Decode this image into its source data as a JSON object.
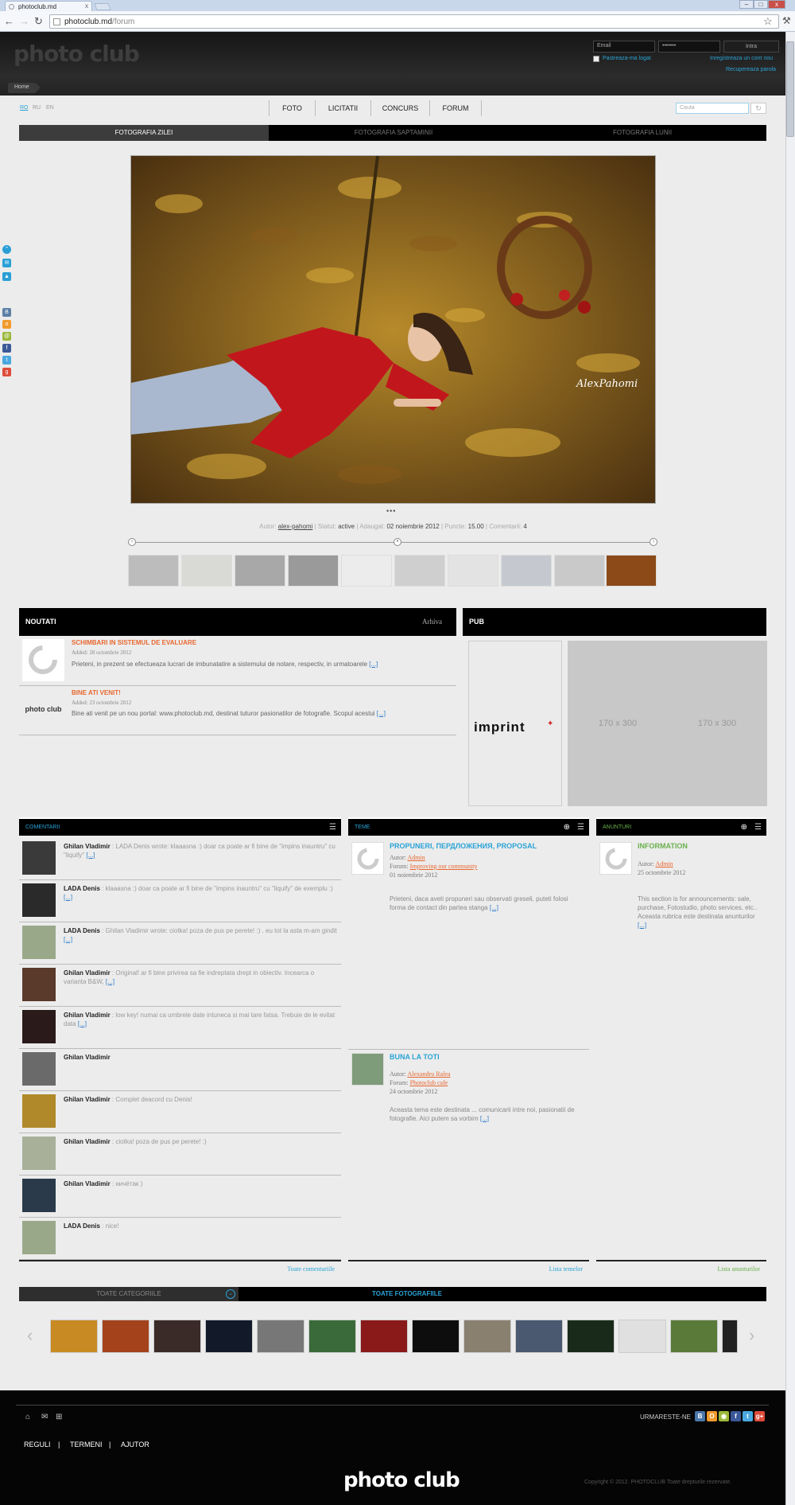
{
  "browser": {
    "tab_title": "photoclub.md",
    "url_host": "photoclub.md",
    "url_path": "/forum",
    "new_tab": "+",
    "close": "x",
    "back": "←",
    "forward": "→",
    "reload": "↻",
    "bookmark": "☆",
    "menu": "🔧",
    "min": "–",
    "max": "□",
    "win_close": "x"
  },
  "header": {
    "logo": "photo club",
    "email_placeholder": "Email",
    "password_value": "•••••••",
    "login_label": "Intra",
    "remember_label": "Pastreaza-ma logat",
    "register_label": "Inregistreaza un cont nou",
    "recover_label": "Recupereaza parola",
    "breadcrumb": "Home"
  },
  "languages": [
    "RO",
    "RU",
    "EN"
  ],
  "nav": [
    "FOTO",
    "LICITATII",
    "CONCURS",
    "FORUM"
  ],
  "search": {
    "placeholder": "Cauta",
    "button": "↻"
  },
  "photo_tabs": [
    "FOTOGRAFIA ZILEI",
    "FOTOGRAFIA SAPTAMINII",
    "FOTOGRAFIA LUNII"
  ],
  "photo": {
    "watermark": "AlexPahomi",
    "dots": "•••",
    "author_label": "Autor:",
    "author": "alex-pahomi",
    "status_label": "Statut:",
    "status": "active",
    "added_label": "Adaugat:",
    "added": "02 noiembrie 2012",
    "points_label": "Puncte:",
    "points": "15.00",
    "comments_label": "Comentarii:",
    "comments": "4",
    "prev": "‹",
    "next": "›",
    "mid": "•"
  },
  "news": {
    "title": "NOUTATI",
    "archive": "Arhiva",
    "items": [
      {
        "title": "SCHIMBARI IN SISTEMUL DE EVALUARE",
        "date": "Added: 28 octombrie 2012",
        "text": "Prieteni, in prezent se efectueaza lucrari de imbunatatire a sistemului de notare, respectiv, in urmatoarele",
        "more": "[...]"
      },
      {
        "title": "BINE ATI VENIT!",
        "date": "Added: 23 octombrie 2012",
        "text": "Bine ati venit pe un nou portal: www.photoclub.md, destinat tuturor pasionatilor de fotografie. Scopul acestui",
        "more": "[...]",
        "icon_text": "photo club"
      }
    ]
  },
  "pub": {
    "title": "PUB",
    "imprint": "imprint",
    "ad1": "170 x 300",
    "ad2": "170 x 300"
  },
  "comments": {
    "title": "COMENTARII",
    "footer": "Toate comentariile",
    "items": [
      {
        "name": "Ghilan Vladimir",
        "text": ": LADA Denis wrote: klaaasna :) doar ca  poate ar fi bine de \"impins inauntru\" cu \"liquify\"",
        "more": "[...]"
      },
      {
        "name": "LADA Denis",
        "text": ": klaaasna :) doar ca  poate ar fi bine de \"impins inauntru\" cu \"liquify\" de exemplu :)",
        "more": "[...]"
      },
      {
        "name": "LADA Denis",
        "text": ": Ghilan Vladimir wrote: ciotka! poza de pus pe perete! :) . eu tot la asta m-am gindit",
        "more": "[...]"
      },
      {
        "name": "Ghilan Vladimir",
        "text": ": Original! ar fi bine privirea sa fie indreptata drept in obiectiv. Incearca o varianta B&W,",
        "more": "[...]"
      },
      {
        "name": "Ghilan Vladimir",
        "text": ": low key!  numai ca umbrele date intuneca si mai tare fatsa. Trebuie de le evitat data",
        "more": "[...]"
      },
      {
        "name": "Ghilan Vladimir",
        "text": "",
        "more": ""
      },
      {
        "name": "Ghilan Vladimir",
        "text": ": Complet deacord cu Denis!",
        "more": ""
      },
      {
        "name": "Ghilan Vladimir",
        "text": ": ciotka! poza de pus pe perete! :)",
        "more": ""
      },
      {
        "name": "Ghilan Vladimir",
        "text": ": ничётак )",
        "more": ""
      },
      {
        "name": "LADA Denis",
        "text": ": nice!",
        "more": ""
      }
    ]
  },
  "topics": {
    "title": "TEME",
    "footer": "Lista temelor",
    "add": "⊕",
    "list": "☰",
    "items": [
      {
        "title": "PROPUNERI, ПЕРДЛОЖЕНИЯ, PROPOSAL",
        "author_label": "Autor:",
        "author": "Admin",
        "forum_label": "Forum:",
        "forum": "Improving our community",
        "date": "01 noiembrie 2012",
        "text": "Prieteni, daca aveti propuneri sau observati greseli, puteti folosi forma de contact din partea stanga",
        "more": "[...]"
      },
      {
        "title": "BUNA LA TOTI",
        "author_label": "Autor:",
        "author": "Alexandru Ralea",
        "forum_label": "Forum:",
        "forum": "Photoclub cafe",
        "date": "24 octombrie 2012",
        "text": "Aceasta tema este destinata ... comunicarii intre noi, pasionatii de fotografie. Aici putem sa vorbim",
        "more": "[...]"
      }
    ]
  },
  "announcements": {
    "title": "ANUNTURI",
    "footer": "Lista anunturilor",
    "item": {
      "title": "INFORMATION",
      "author_label": "Autor:",
      "author": "Admin",
      "date": "25 octombrie 2012",
      "text": "This section is for announcements: sale, purchase, Fotostudio, photo services, etc.. Aceasta rubrica este destinata anunturilor",
      "more": "[...]"
    }
  },
  "gallery": {
    "category": "TOATE CATEGORIILE",
    "drop": "⌄",
    "all": "TOATE FOTOGRAFIILE",
    "prev": "‹",
    "next": "›"
  },
  "footer": {
    "follow": "URMARESTE-NE",
    "links": [
      "REGULI",
      "TERMENI",
      "AJUTOR"
    ],
    "sep": "|",
    "logo": "photo club",
    "copyright": "Copyright © 2012. PHOTOCLUB Toate drepturile rezervate.",
    "home_icon": "⌂",
    "mail_icon": "✉",
    "sitemap_icon": "⊞"
  },
  "social": [
    "B",
    "O",
    "◉",
    "f",
    "t",
    "g+"
  ],
  "colors": {
    "accent": "#2aa3d6",
    "orange": "#e8672f",
    "green": "#6ab04c"
  }
}
